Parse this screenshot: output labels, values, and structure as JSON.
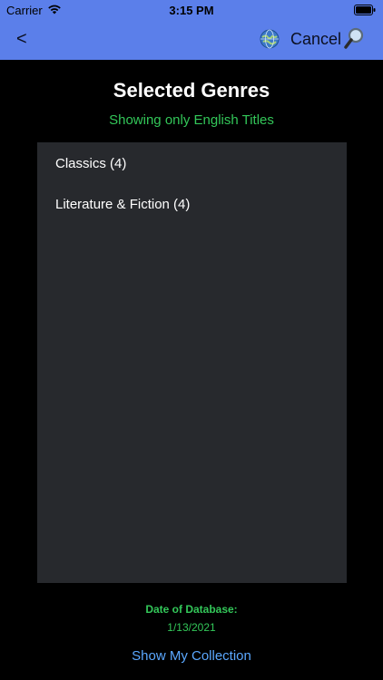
{
  "status_bar": {
    "carrier": "Carrier",
    "time": "3:15 PM",
    "icons": [
      "wifi-icon",
      "battery-icon"
    ]
  },
  "nav": {
    "back_label": "<",
    "cancel_label": "Cancel",
    "icons": [
      "globe-icon",
      "magnifier-icon"
    ],
    "bar_color": "#5b7fea"
  },
  "header": {
    "title": "Selected Genres",
    "subtitle": "Showing only English Titles",
    "subtitle_color": "#33c759"
  },
  "genres": [
    {
      "label": "Classics (4)"
    },
    {
      "label": "Literature & Fiction (4)"
    }
  ],
  "footer": {
    "db_label": "Date of Database:",
    "db_date": "1/13/2021",
    "collection_button": "Show My Collection",
    "link_color": "#5ba8ff"
  }
}
